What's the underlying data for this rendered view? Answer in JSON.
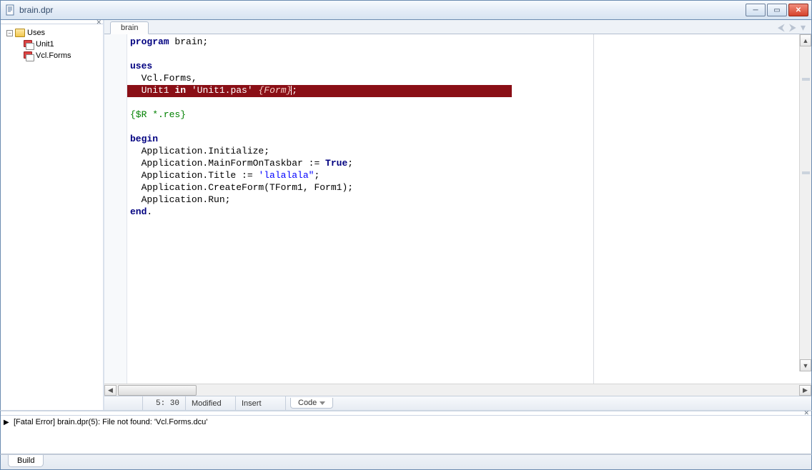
{
  "window": {
    "title": "brain.dpr"
  },
  "tree": {
    "root": "Uses",
    "items": [
      "Unit1",
      "Vcl.Forms"
    ]
  },
  "editor": {
    "tab": "brain",
    "cursor": "5: 30",
    "modified": "Modified",
    "insert_mode": "Insert",
    "view_tab": "Code"
  },
  "code": {
    "l1a": "program",
    "l1b": " brain;",
    "l3": "uses",
    "l4": "  Vcl.Forms,",
    "l5a": "  Unit1 ",
    "l5b": "in",
    "l5c": " ",
    "l5d": "'Unit1.pas'",
    "l5e": " ",
    "l5f": "{Form}",
    "l5g": ";",
    "l7": "{$R *.res}",
    "l9": "begin",
    "l10": "  Application.Initialize;",
    "l11a": "  Application.MainFormOnTaskbar := ",
    "l11b": "True",
    "l11c": ";",
    "l12a": "  Application.Title := ",
    "l12b": "'lalalala\"",
    "l12c": ";",
    "l13": "  Application.CreateForm(TForm1, Form1);",
    "l14": "  Application.Run;",
    "l15a": "end",
    "l15b": "."
  },
  "messages": {
    "item": "[Fatal Error] brain.dpr(5): File not found: 'Vcl.Forms.dcu'"
  },
  "bottom_tab": "Build"
}
